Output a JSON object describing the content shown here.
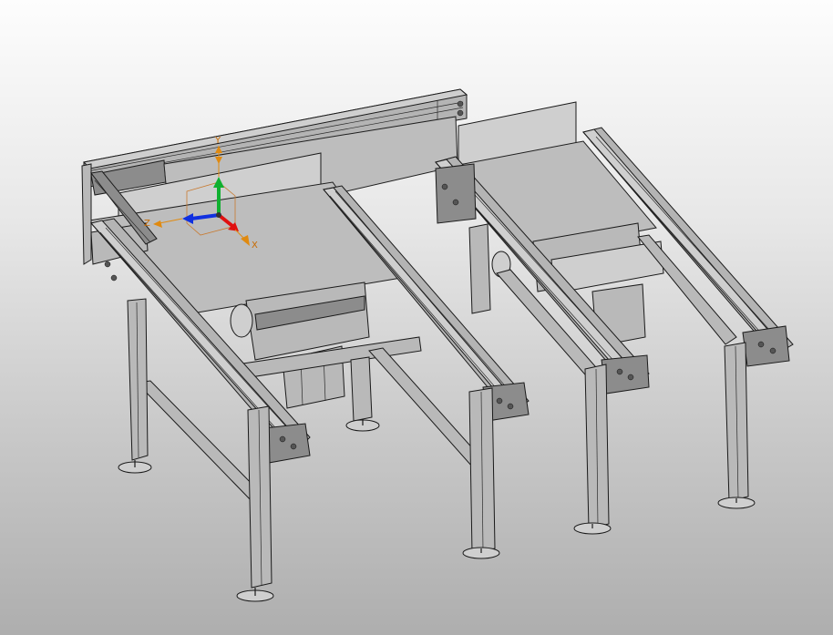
{
  "viewport": {
    "background_top": "#fdfdfd",
    "background_bottom": "#aeaeae",
    "model_color": "#bdbdbd",
    "edge_color": "#1a1a1a"
  },
  "triad": {
    "x_color": "#e01010",
    "y_color": "#10b030",
    "z_color": "#1030e0",
    "handle_color": "#e08a10",
    "label_x": "X",
    "label_y": "Y",
    "label_z": "Z"
  }
}
